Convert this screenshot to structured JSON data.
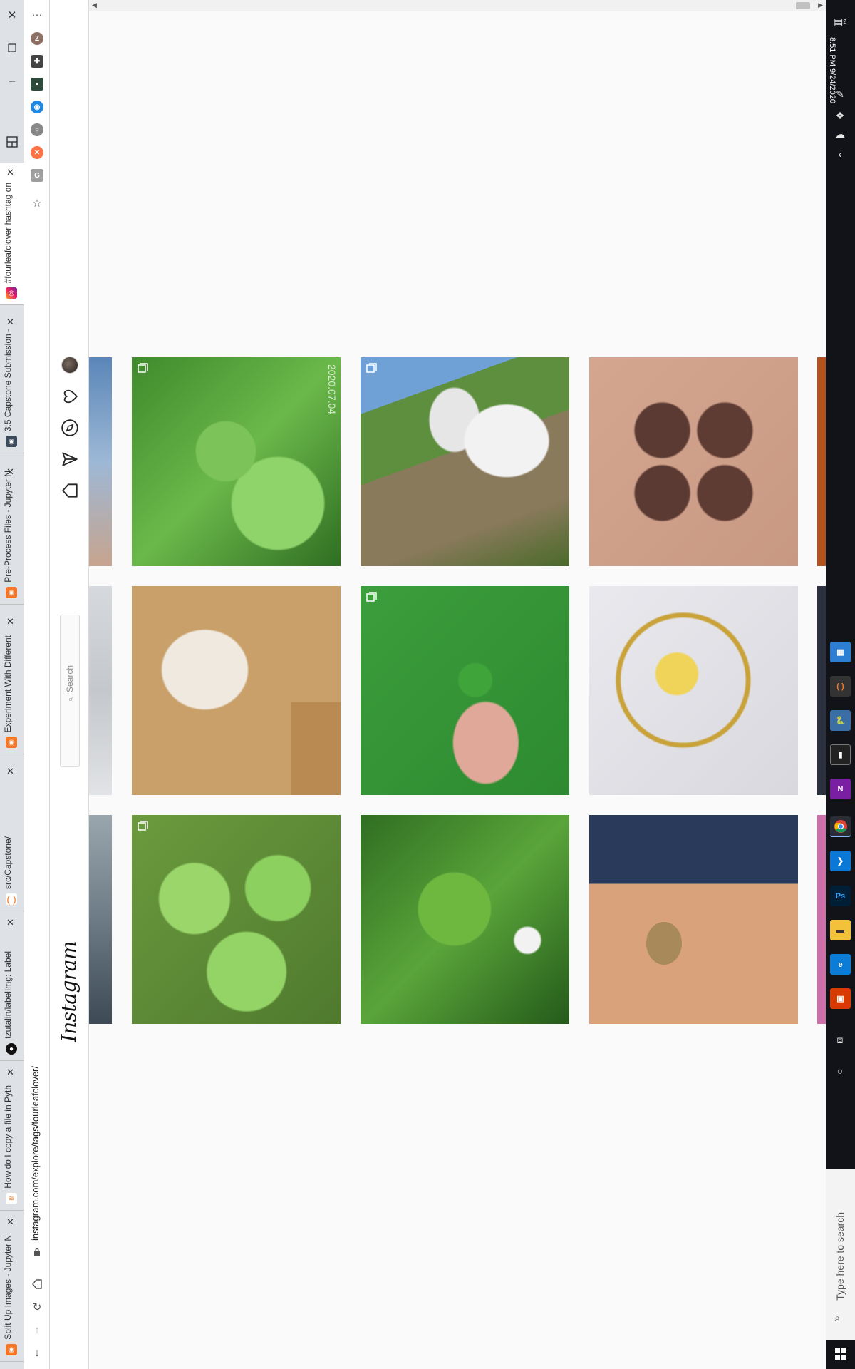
{
  "browser": {
    "tabs": [
      {
        "title": "#fourleafclover hashtag on",
        "favicon": "instagram-icon",
        "active": true
      },
      {
        "title": "3.5 Capstone Submission -",
        "favicon": "jupyter-icon",
        "active": false
      },
      {
        "title": "Pre-Process Files - Jupyter N",
        "favicon": "jupyter-icon",
        "active": false
      },
      {
        "title": "Experiment With Different",
        "favicon": "jupyter-icon",
        "active": false
      },
      {
        "title": "src/Capstone/",
        "favicon": "jupyter-icon",
        "active": false
      },
      {
        "title": "tzutalin/labelImg: Label",
        "favicon": "github-icon",
        "active": false
      },
      {
        "title": "How do I copy a file in Pyth",
        "favicon": "stackoverflow-icon",
        "active": false
      },
      {
        "title": "Split Up Images - Jupyter N",
        "favicon": "jupyter-icon",
        "active": false
      }
    ],
    "url": "instagram.com/explore/tags/fourleafclover/"
  },
  "instagram": {
    "logo": "Instagram",
    "search_placeholder": "Search",
    "posts": [
      {
        "row": 1,
        "col": 1,
        "description": "clover-leaves-grass",
        "overlay": "2020.07.04",
        "multi": true
      },
      {
        "row": 1,
        "col": 2,
        "description": "calves-hutches",
        "overlay": "",
        "multi": true
      },
      {
        "row": 1,
        "col": 3,
        "description": "clover-tattoo",
        "overlay": "",
        "multi": false
      },
      {
        "row": 2,
        "col": 1,
        "description": "fabric-books",
        "overlay": "",
        "multi": false
      },
      {
        "row": 2,
        "col": 2,
        "description": "hand-holding-clover",
        "overlay": "",
        "multi": true
      },
      {
        "row": 2,
        "col": 3,
        "description": "faith-bracelet",
        "overlay": "",
        "multi": false
      },
      {
        "row": 3,
        "col": 1,
        "description": "clover-patch",
        "overlay": "",
        "multi": true
      },
      {
        "row": 3,
        "col": 2,
        "description": "clover-sunlit",
        "overlay": "",
        "multi": false
      },
      {
        "row": 3,
        "col": 3,
        "description": "necklace-charm",
        "overlay": "",
        "multi": false
      }
    ]
  },
  "taskbar": {
    "time": "8:51 PM",
    "date": "9/24/2020",
    "search_placeholder": "Type here to search",
    "notification_count": "2"
  }
}
